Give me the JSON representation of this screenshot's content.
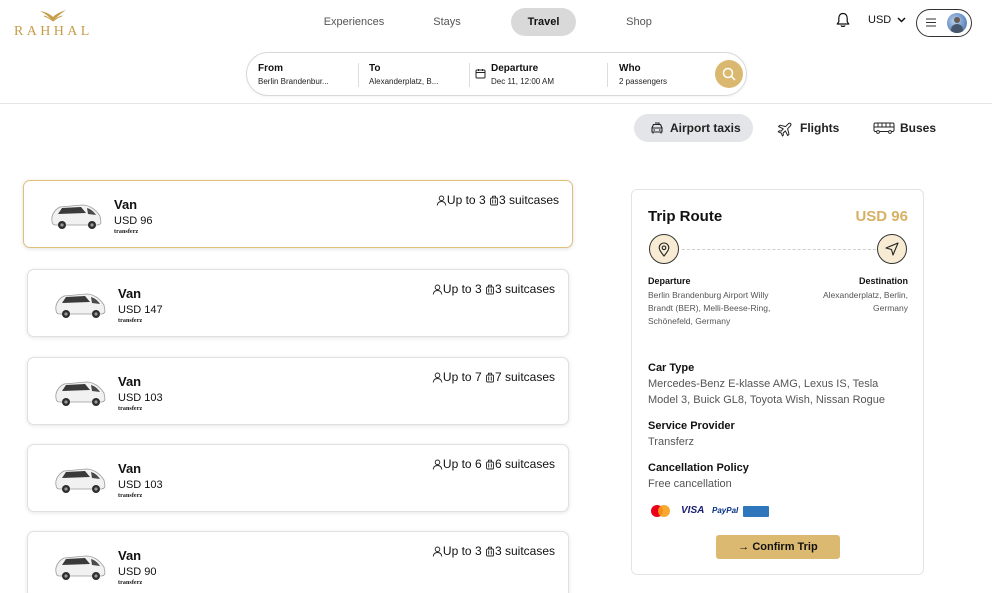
{
  "brand": {
    "name": "RAHHAL",
    "color": "#c79d4a"
  },
  "nav": {
    "items": [
      {
        "label": "Experiences",
        "active": false
      },
      {
        "label": "Stays",
        "active": false
      },
      {
        "label": "Travel",
        "active": true
      },
      {
        "label": "Shop",
        "active": false
      }
    ]
  },
  "header": {
    "currency": "USD",
    "icons": [
      "bell-icon",
      "chevron-down-icon",
      "menu-icon",
      "avatar"
    ]
  },
  "search": {
    "from": {
      "label": "From",
      "value": "Berlin Brandenbur..."
    },
    "to": {
      "label": "To",
      "value": "Alexanderplatz, B..."
    },
    "departure": {
      "label": "Departure",
      "value": "Dec 11, 12:00 AM"
    },
    "who": {
      "label": "Who",
      "value": "2 passengers"
    },
    "button_color": "#dab86f"
  },
  "categories": [
    {
      "label": "Airport taxis",
      "icon": "taxi-icon",
      "active": true
    },
    {
      "label": "Flights",
      "icon": "airplane-icon",
      "active": false
    },
    {
      "label": "Buses",
      "icon": "bus-icon",
      "active": false
    }
  ],
  "results": [
    {
      "title": "Van",
      "price": "USD 96",
      "provider": "transferz",
      "capacity": "Up to 3",
      "luggage": "3 suitcases",
      "selected": true
    },
    {
      "title": "Van",
      "price": "USD 147",
      "provider": "transferz",
      "capacity": "Up to 3",
      "luggage": "3 suitcases",
      "selected": false
    },
    {
      "title": "Van",
      "price": "USD 103",
      "provider": "transferz",
      "capacity": "Up to 7",
      "luggage": "7 suitcases",
      "selected": false
    },
    {
      "title": "Van",
      "price": "USD 103",
      "provider": "transferz",
      "capacity": "Up to 6",
      "luggage": "6 suitcases",
      "selected": false
    },
    {
      "title": "Van",
      "price": "USD 90",
      "provider": "transferz",
      "capacity": "Up to 3",
      "luggage": "3 suitcases",
      "selected": false
    }
  ],
  "trip": {
    "title": "Trip Route",
    "total": "USD 96",
    "departure_label": "Departure",
    "departure_value": "Berlin Brandenburg Airport Willy Brandt (BER), Melli-Beese-Ring, Schönefeld, Germany",
    "destination_label": "Destination",
    "destination_value": "Alexanderplatz, Berlin, Germany",
    "car_type_label": "Car Type",
    "car_type_value": "Mercedes-Benz E-klasse AMG, Lexus IS, Tesla Model 3, Buick GL8, Toyota Wish, Nissan Rogue",
    "provider_label": "Service Provider",
    "provider_value": "Transferz",
    "cancellation_label": "Cancellation Policy",
    "cancellation_value": "Free cancellation",
    "payment": {
      "visa": "VISA",
      "paypal": "PayPal"
    },
    "confirm_label": "→ Confirm Trip",
    "accent": "#d7b064"
  }
}
